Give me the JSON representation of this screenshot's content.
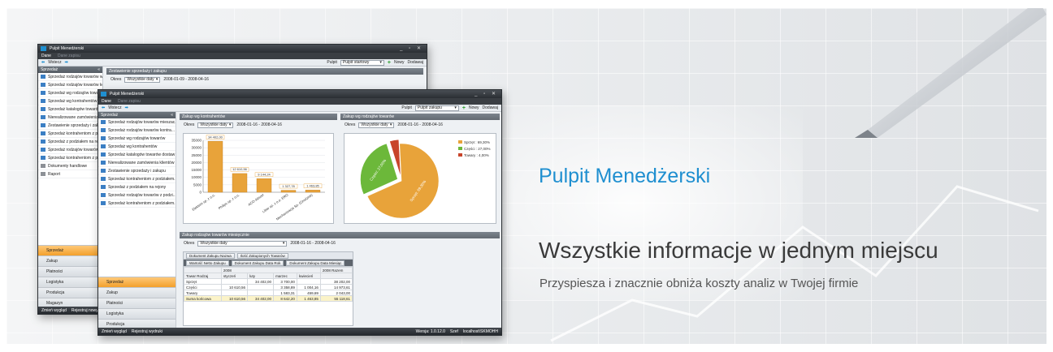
{
  "banner": {
    "title": "Pulpit Menedżerski",
    "tagline": "Wszystkie informacje w jednym miejscu",
    "subtitle": "Przyspiesza i znacznie obniża koszty analiz w Twojej firmie"
  },
  "colors": {
    "accent": "#1f8fd0",
    "active_nav": "#f3a02c",
    "tagline": "#3a3a3a"
  },
  "back_window": {
    "title": "Pulpit Menedżerski",
    "menu": [
      "Dane",
      "Dane zapisu"
    ],
    "back_label": "Wstecz",
    "pulpit_label": "Pulpit",
    "pulpit_value": "Pulpit startowy",
    "new_label": "Nowy",
    "settings_label": "Dodawaj",
    "sidebar_header": "Sprzedaż",
    "panel_title": "Zestawienie sprzedaży i zakupu",
    "filter_label": "Okres",
    "filter_value": "Wszystkie daty",
    "date_range": "2008-01-09 - 2008-04-16",
    "items": [
      "Sprzedaż rodzajów towarów weid...",
      "Sprzedaż rodzajów towarów kontr...",
      "Sprzedaż wg rodzajów towarów",
      "Sprzedaż wg kontrahentów",
      "Sprzedaż katalogów towarów",
      "Nierealizowane zamówienia",
      "Zestawienie sprzedaży i zakupu",
      "Sprzedaż kontrahentom z pod...",
      "Sprzedaż z podziałem na rejon",
      "Sprzedaż rodzajów towarów",
      "Sprzedaż kontrahentom z pod...",
      "Dokumenty handlowe",
      "Raport"
    ],
    "categories": [
      "Sprzedaż",
      "Zakup",
      "Płatności",
      "Logistyka",
      "Produkcja",
      "Magazyn"
    ],
    "status_left": [
      "Zmień wygląd",
      "Rejestruj nowy"
    ]
  },
  "front_window": {
    "title": "Pulpit Menedżerski",
    "menu": [
      "Dane",
      "Dane zapisu"
    ],
    "back_label": "Wstecz",
    "pulpit_label": "Pulpit",
    "pulpit_value": "Pulpit zakupu",
    "new_label": "Nowy",
    "settings_label": "Dodawaj",
    "sidebar_header": "Sprzedaż",
    "items": [
      "Sprzedaż rodzajów towarów mieszac...",
      "Sprzedaż rodzajów towarów kontra...",
      "Sprzedaż wg rodzajów towarów",
      "Sprzedaż wg kontrahentów",
      "Sprzedaż katalogów towarów dostaw",
      "Nierealizowane zamówienia klientów",
      "Zestawienie sprzedaży i zakupu",
      "Sprzedaż kontrahentom z podziałem...",
      "Sprzedaż z podziałem na rejony",
      "Sprzedaż rodzajów towarów z podzi...",
      "Sprzedaż kontrahentom z podziałem..."
    ],
    "categories": [
      "Sprzedaż",
      "Zakup",
      "Płatności",
      "Logistyka",
      "Produkcja"
    ],
    "status_left": [
      "Zmień wygląd",
      "Rejestruj wydruki"
    ],
    "status_right": [
      "Wersja: 1.0.12.0",
      "Szef",
      "localhost\\SKMOHH"
    ],
    "bar_panel": {
      "title": "Zakup wg kontrahentów",
      "filter_label": "Okres",
      "filter_value": "Wszystkie daty",
      "date_range": "2008-01-16 - 2008-04-16"
    },
    "pie_panel": {
      "title": "Zakup wg rodzajów towarów",
      "filter_label": "Okres",
      "filter_value": "Wszystkie daty",
      "date_range": "2008-01-16 - 2008-04-16"
    },
    "pivot_panel": {
      "title": "Zakup rodzajów towarów miesięcznie",
      "filter_label": "Okres",
      "filter_value": "Wszystkie daty",
      "date_range": "2008-01-16 - 2008-04-16",
      "row_fields": [
        "Dokument Zakupu Nazwa",
        "Ilość Zakupionych Towarów"
      ],
      "col_fields": [
        "Wartość Netto Zakupu",
        "Dokument Zakupu Data Rok",
        "Dokument Zakupu Data Miesiąc"
      ],
      "year": "2008",
      "year_total": "2008 Razem",
      "row_header": "Towar Rodzaj",
      "months": [
        "styczeń",
        "luty",
        "marzec",
        "kwiecień"
      ],
      "rows": [
        {
          "label": "Sprzęt",
          "vals": [
            "",
            "34 402,00",
            "3 700,00",
            ""
          ],
          "total": "38 202,00"
        },
        {
          "label": "Części",
          "vals": [
            "10 610,56",
            "",
            "3 358,89",
            "1 004,16"
          ],
          "total": "14 973,61"
        },
        {
          "label": "Towary",
          "vals": [
            "",
            "",
            "1 583,31",
            "459,69"
          ],
          "total": "2 043,00"
        },
        {
          "label": "Suma końcowa",
          "vals": [
            "10 610,56",
            "34 402,00",
            "8 642,20",
            "1 463,85"
          ],
          "total": "55 118,61"
        }
      ]
    }
  },
  "chart_data": [
    {
      "type": "bar",
      "categories": [
        "Elektrim sp. z o.o.",
        "Philips sp. z o.o.",
        "ACO-Absort",
        "Litter sp. z o.o. ERO",
        "Mechanizacja Sp. (Grodzisk)"
      ],
      "values": [
        34402,
        12610.56,
        9144.24,
        1327.78,
        1463.85
      ],
      "data_labels": [
        "34 402,00",
        "12 610,56",
        "9 144,24",
        "1 327,78",
        "1 463,85"
      ],
      "y_ticks": [
        "0",
        "5000",
        "10000",
        "15000",
        "20000",
        "25000",
        "30000",
        "35000"
      ],
      "ylim": [
        0,
        35000
      ],
      "color": "#e8a33a"
    },
    {
      "type": "pie",
      "slices": [
        {
          "name": "Sprzęt",
          "value": 69.3,
          "label": "Sprzęt: 69,30%",
          "legend": "Sprzęt : 69,30%",
          "color": "#e8a33a"
        },
        {
          "name": "Części",
          "value": 27.0,
          "label": "Części: 27,00%",
          "legend": "Części : 27,00%",
          "color": "#6cb83a"
        },
        {
          "name": "Towary",
          "value": 4.0,
          "label": "",
          "legend": "Towary : 4,00%",
          "color": "#c8442a"
        }
      ]
    }
  ]
}
